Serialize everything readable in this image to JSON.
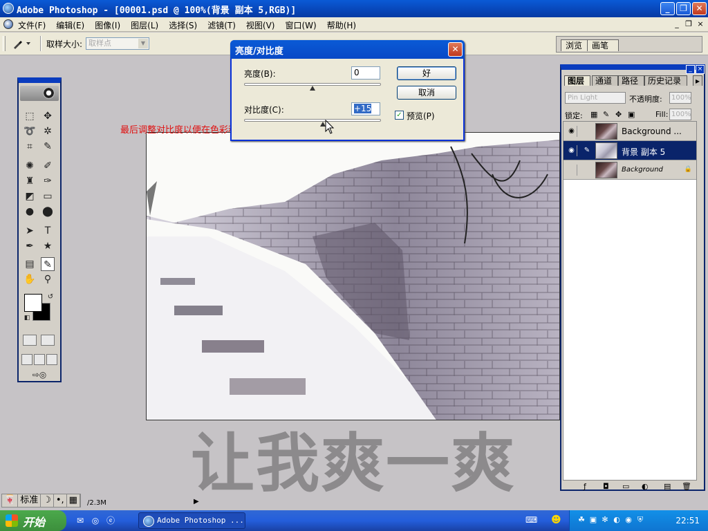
{
  "window": {
    "title": "Adobe Photoshop - [00001.psd @ 100%(背景 副本 5,RGB)]",
    "minimize": "_",
    "maximize": "❐",
    "close": "✕"
  },
  "menu": {
    "items": [
      "文件(F)",
      "编辑(E)",
      "图像(I)",
      "图层(L)",
      "选择(S)",
      "滤镜(T)",
      "视图(V)",
      "窗口(W)",
      "帮助(H)"
    ],
    "doc_controls": [
      "_",
      "❐",
      "×"
    ]
  },
  "options": {
    "tool_icon": "eyedropper-icon",
    "sample_label": "取样大小:",
    "sample_value": "取样点",
    "well_tabs": [
      "浏览",
      "画笔"
    ]
  },
  "caption": "最后调整对比度以便在色彩和对比度上和新的素材层相配",
  "watermark": "让我爽一爽",
  "dialog": {
    "title": "亮度/对比度",
    "brightness_label": "亮度(B):",
    "brightness_value": "0",
    "contrast_label": "对比度(C):",
    "contrast_value": "+15",
    "brightness_level": 0,
    "contrast_level": 15,
    "ok": "好",
    "cancel": "取消",
    "preview_label": "预览(P)",
    "preview_checked": true
  },
  "layers_palette": {
    "tabs": [
      "图层",
      "通道",
      "路径",
      "历史记录"
    ],
    "blend_mode": "Pin Light",
    "opacity_label": "不透明度:",
    "opacity_value": "100%",
    "lock_label": "锁定:",
    "fill_label": "Fill:",
    "fill_value": "100%",
    "layers": [
      {
        "name": "Background ...",
        "visible": true,
        "selected": false
      },
      {
        "name": "背景 副本 5",
        "visible": true,
        "selected": true
      },
      {
        "name": "Background",
        "visible": false,
        "selected": false,
        "locked": true
      }
    ]
  },
  "status": {
    "ime": [
      "标准",
      "☽",
      "•,",
      "▦"
    ],
    "doc_size": "/2.3M"
  },
  "taskbar": {
    "start": "开始",
    "task_label": "Adobe Photoshop ...",
    "clock": "22:51"
  }
}
